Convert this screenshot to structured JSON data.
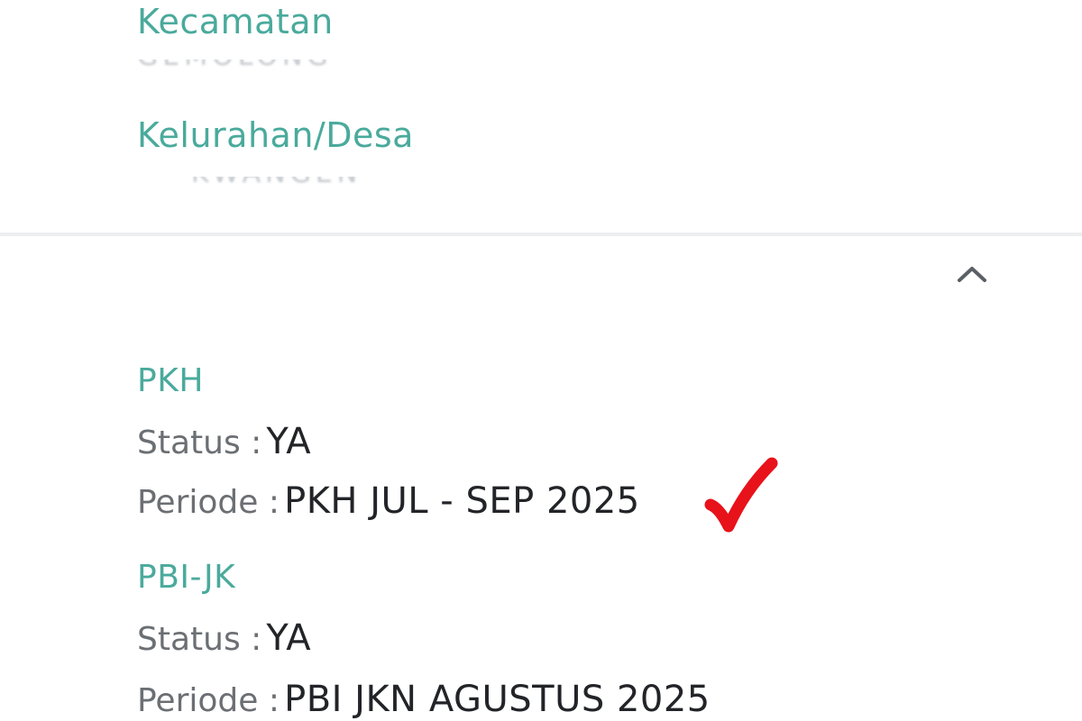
{
  "location": {
    "kecamatan": {
      "label": "Kecamatan",
      "value": "GEMOLONG"
    },
    "kelurahan": {
      "label": "Kelurahan/Desa",
      "value": "KWANGEN"
    }
  },
  "icons": {
    "collapse": "chevron-up-icon",
    "annotation": "red-checkmark"
  },
  "colors": {
    "accent": "#4aaa9c",
    "key_text": "#6b6f73",
    "value_text": "#222428",
    "checkmark": "#e8121a"
  },
  "programs": [
    {
      "title": "PKH",
      "status_label": "Status :",
      "status_value": "YA",
      "periode_label": "Periode :",
      "periode_value": "PKH JUL - SEP 2025"
    },
    {
      "title": "PBI-JK",
      "status_label": "Status :",
      "status_value": "YA",
      "periode_label": "Periode :",
      "periode_value": "PBI JKN AGUSTUS 2025"
    }
  ]
}
